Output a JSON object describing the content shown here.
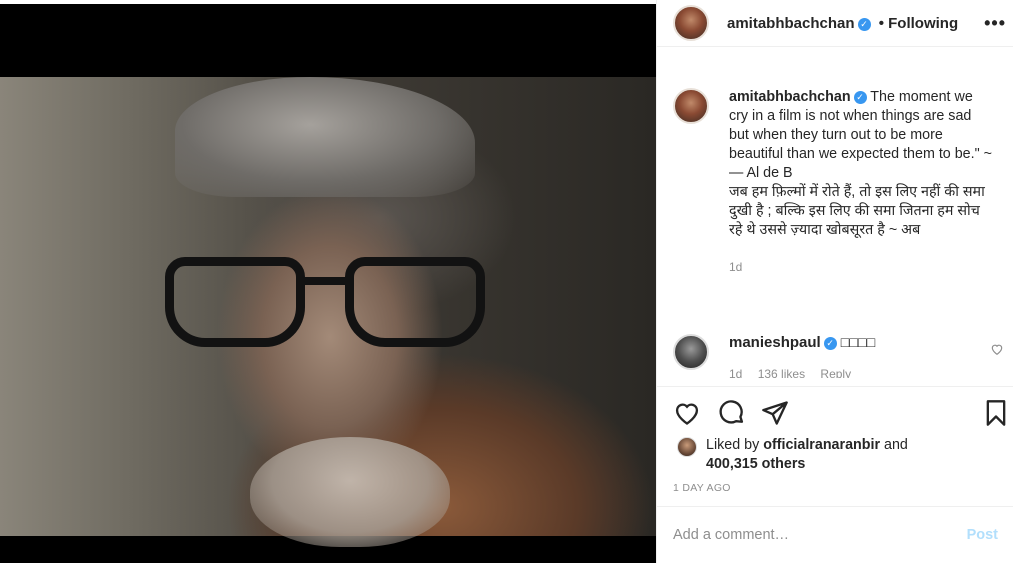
{
  "post": {
    "author": "amitabhbachchan",
    "follow_state": "• Following",
    "verified_mark": "✓",
    "more_icon": "more-horizontal-icon"
  },
  "caption": {
    "username": "amitabhbachchan",
    "text": "The moment we cry in a film is not when things are sad but when they turn out to be more beautiful than we expected them to be.\" ~\n— Al de B\nजब हम फ़िल्मों में रोते हैं, तो इस लिए नहीं की समा दुखी है ; बल्कि इस लिए की समा जितना हम सोच रहे थे उससे ज़्यादा खोबसूरत है ~ अब",
    "time": "1d"
  },
  "comment": {
    "username": "manieshpaul",
    "text": "□□□□",
    "time": "1d",
    "likes": "136 likes",
    "reply": "Reply"
  },
  "likes": {
    "prefix": "Liked by ",
    "user": "officialranaranbir",
    "middle": " and",
    "others": "400,315 others"
  },
  "post_time": "1 DAY AGO",
  "add_comment": {
    "placeholder": "Add a comment…",
    "post_label": "Post"
  },
  "colors": {
    "verified": "#3897f0",
    "post_button_disabled": "#b2dffc",
    "muted_text": "#8e8e8e"
  }
}
